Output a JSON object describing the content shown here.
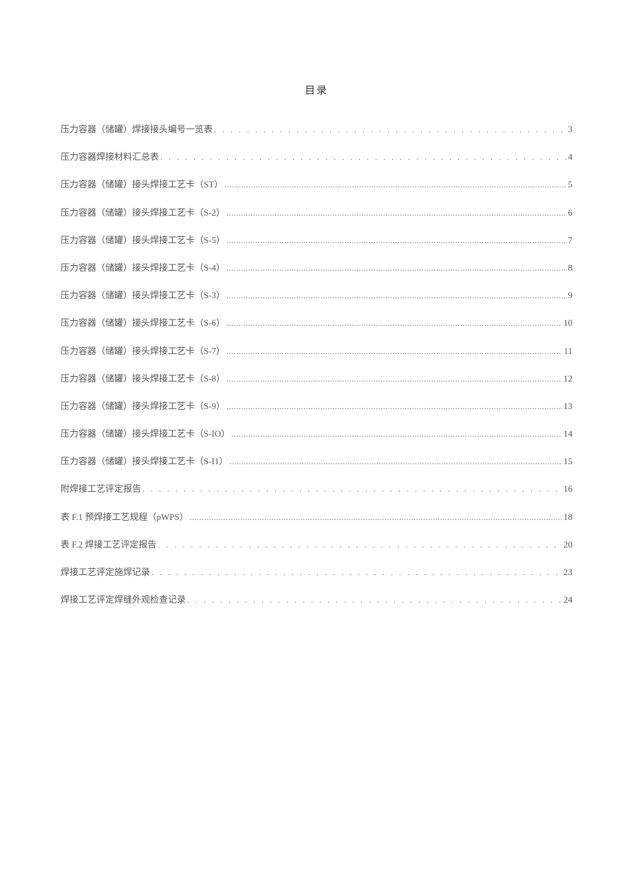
{
  "title": "目录",
  "toc": [
    {
      "label": "压力容器（储罐）焊接接头编号一览表",
      "page": "3",
      "dotStyle": "wide"
    },
    {
      "label": "压力容器焊接材料汇总表",
      "page": "4",
      "dotStyle": "wide"
    },
    {
      "label": "压力容器（储罐）接头焊接工艺卡（ST）",
      "page": "5",
      "dotStyle": "tight"
    },
    {
      "label": "压力容器（储罐）接头焊接工艺卡（S-2）",
      "page": "6",
      "dotStyle": "tight"
    },
    {
      "label": "压力容器（储罐）接头焊接工艺卡（S-5）",
      "page": "7",
      "dotStyle": "tight"
    },
    {
      "label": "压力容器（储罐）接头焊接工艺卡（S-4）",
      "page": "8",
      "dotStyle": "tight"
    },
    {
      "label": "压力容器（储罐）接头焊接工艺卡（S-3）",
      "page": "9",
      "dotStyle": "tight"
    },
    {
      "label": "压力容器（储罐）接头焊接工艺卡（S-6）",
      "page": "10",
      "dotStyle": "tight"
    },
    {
      "label": "压力容器（储罐）接头焊接工艺卡（S-7）",
      "page": "11",
      "dotStyle": "tight"
    },
    {
      "label": "压力容器（储罐）接头焊接工艺卡（S-8）",
      "page": "12",
      "dotStyle": "tight"
    },
    {
      "label": "压力容器（储罐）接头焊接工艺卡（S-9）",
      "page": "13",
      "dotStyle": "tight"
    },
    {
      "label": "压力容器（储罐）接头焊接工艺卡（S-IO）",
      "page": "14",
      "dotStyle": "tight"
    },
    {
      "label": "压力容器（储罐）接头焊接工艺卡（S-I1）",
      "page": "15",
      "dotStyle": "tight"
    },
    {
      "label": "附焊接工艺评定报告",
      "page": "16",
      "dotStyle": "wide"
    },
    {
      "label": "表 F.1 预焊接工艺规程（pWPS）",
      "page": "18",
      "dotStyle": "tight"
    },
    {
      "label": "表 F.2 焊接工艺评定报告",
      "page": "20",
      "dotStyle": "wide"
    },
    {
      "label": "焊接工艺评定施焊记录",
      "page": "23",
      "dotStyle": "wide"
    },
    {
      "label": "焊接工艺评定焊缝外观检查记录",
      "page": "24",
      "dotStyle": "wide"
    }
  ]
}
